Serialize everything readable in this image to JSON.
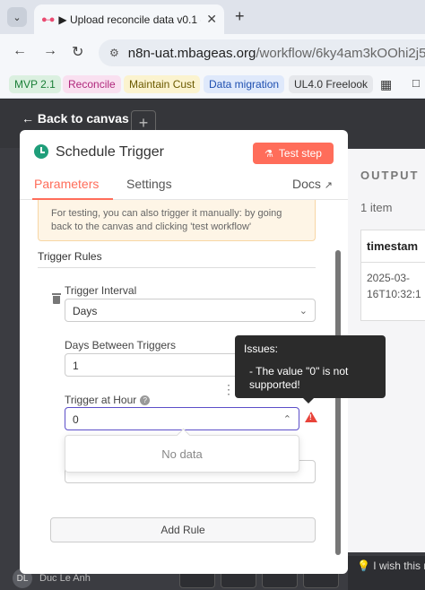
{
  "browser": {
    "tab_title": "▶ Upload reconcile data v0.1 -",
    "url_host": "n8n-uat.mbageas.org",
    "url_path": "/workflow/6ky4am3kOOhi2j5a",
    "bookmarks": [
      {
        "label": "MVP 2.1",
        "color": "#1a7f37",
        "bg": "#dbf0e0"
      },
      {
        "label": "Reconcile",
        "color": "#b0287c",
        "bg": "#f9e0f0"
      },
      {
        "label": "Maintain Cust",
        "color": "#6b5a00",
        "bg": "#fbf3cf"
      },
      {
        "label": "Data migration",
        "color": "#1e4fb0",
        "bg": "#dfe9fb"
      },
      {
        "label": "UL4.0 Freelook",
        "color": "#333333",
        "bg": "#e6e8ec"
      }
    ]
  },
  "canvas": {
    "back_label": "Back to canvas",
    "user_initials": "DL",
    "user_name": "Duc Le Anh",
    "wish_text": "I wish this n"
  },
  "panel": {
    "title": "Schedule Trigger",
    "test_step_label": "Test step",
    "tabs": {
      "parameters": "Parameters",
      "settings": "Settings",
      "docs": "Docs"
    },
    "notice_line1": "For testing, you can also trigger it manually: by going",
    "notice_line2": "back to the canvas and clicking 'test workflow'",
    "trigger_rules_label": "Trigger Rules",
    "trigger_interval_label": "Trigger Interval",
    "trigger_interval_value": "Days",
    "days_between_label": "Days Between Triggers",
    "days_between_value": "1",
    "trigger_hour_label": "Trigger at Hour",
    "trigger_hour_value": "0",
    "no_data": "No data",
    "add_rule_label": "Add Rule"
  },
  "tooltip": {
    "title": "Issues:",
    "message": "- The value \"0\" is not supported!"
  },
  "output": {
    "title": "OUTPUT",
    "count": "1 item",
    "column": "timestam",
    "cell_line1": "2025-03-",
    "cell_line2": "16T10:32:1"
  },
  "colors": {
    "accent": "#ff6d5a",
    "error": "#e8433a",
    "focus": "#5c4ec9"
  }
}
